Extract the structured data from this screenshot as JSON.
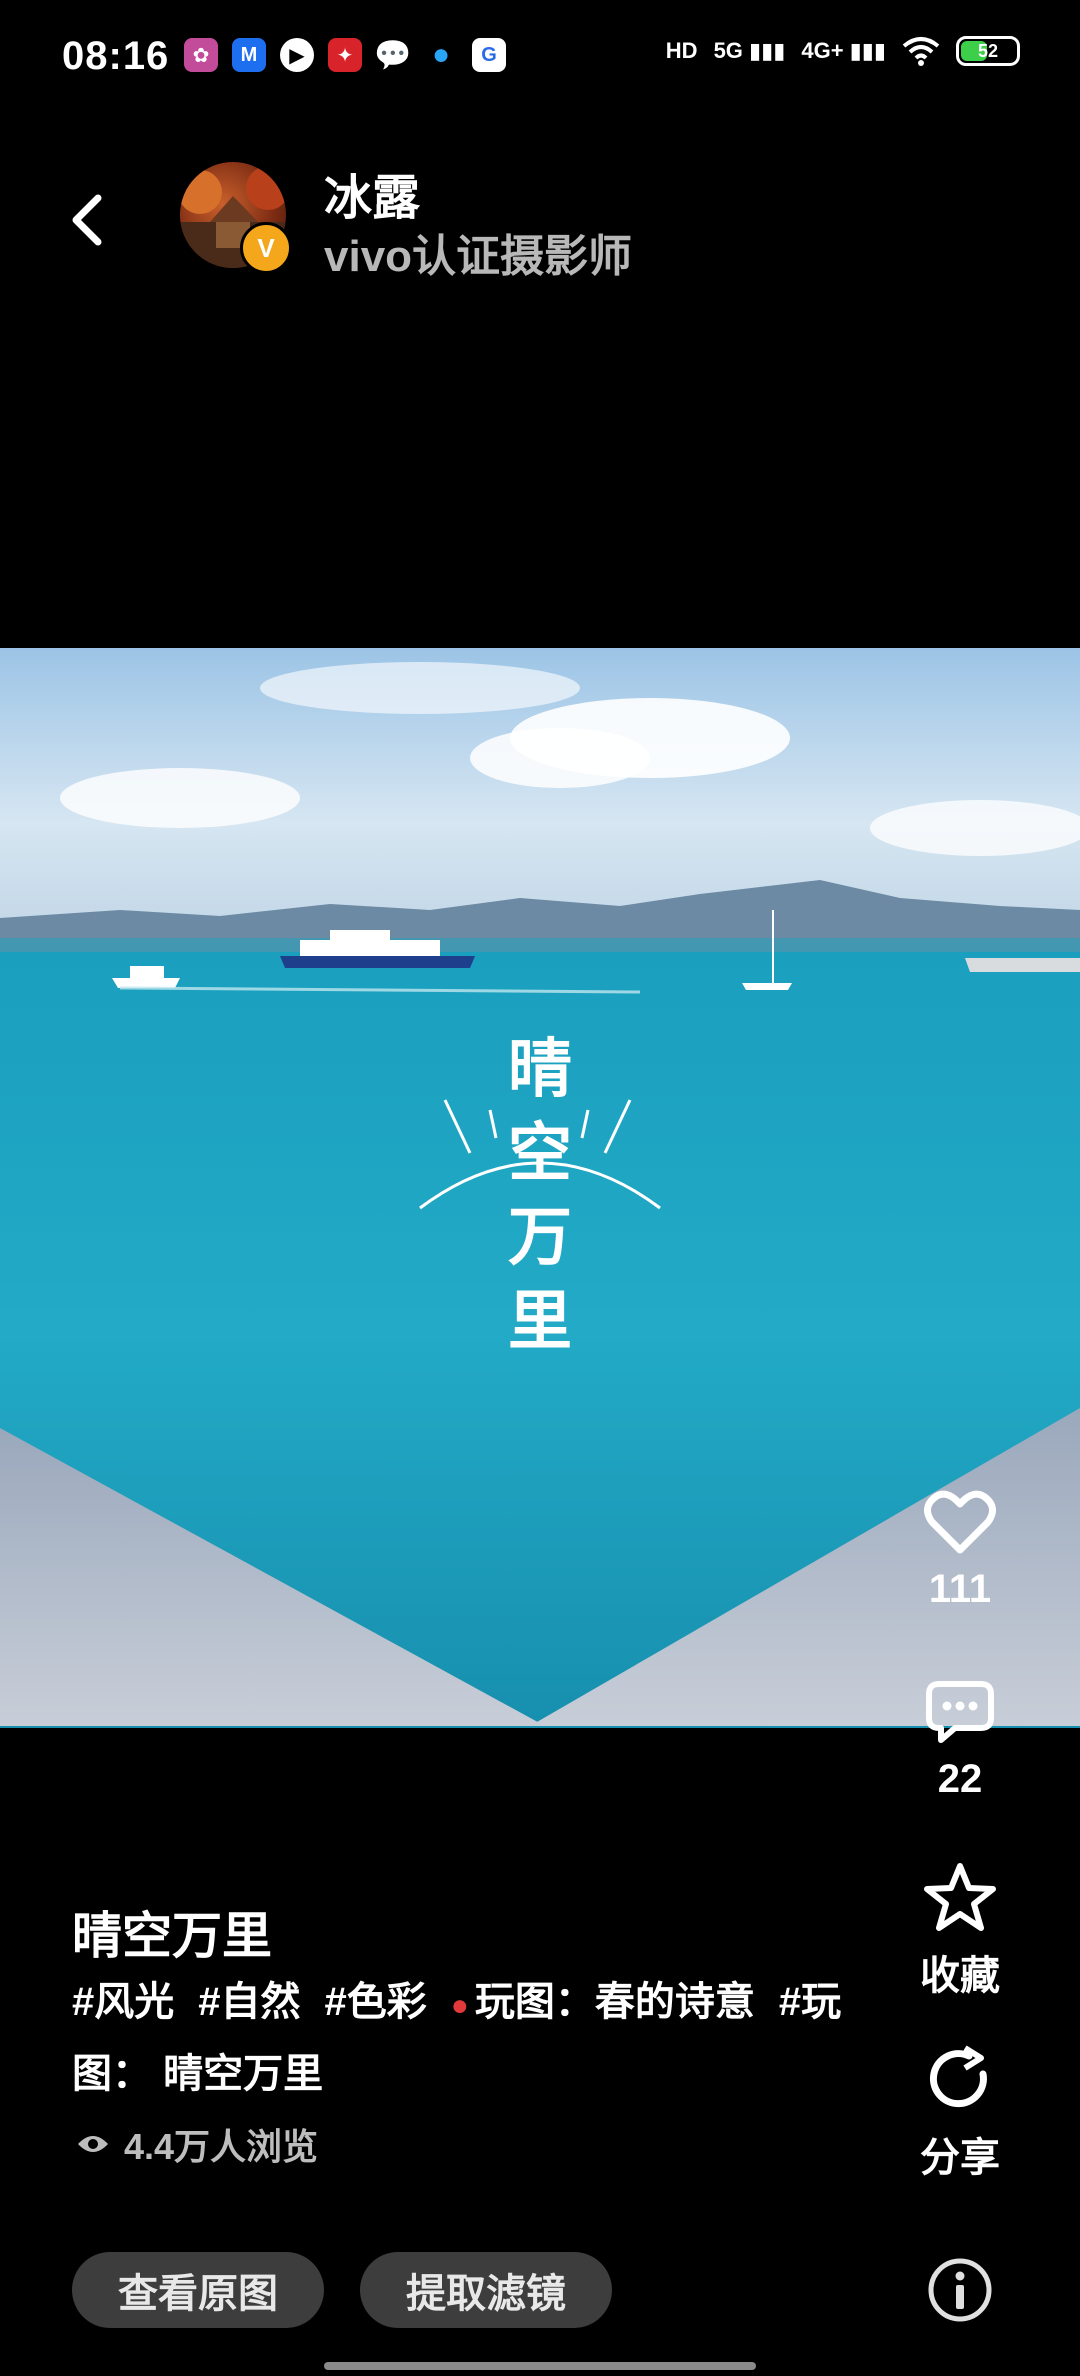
{
  "status": {
    "time": "08:16",
    "network_5g": "5G",
    "network_4g": "4G+",
    "hd_label": "HD",
    "battery_level": "52",
    "battery_fraction": 0.52
  },
  "header": {
    "username": "冰露",
    "subtitle": "vivo认证摄影师",
    "badge_letter": "V"
  },
  "photo": {
    "overlay_text": [
      "晴",
      "空",
      "万",
      "里"
    ]
  },
  "actions": {
    "like_count": "111",
    "comment_count": "22",
    "favorite_label": "收藏",
    "share_label": "分享"
  },
  "post": {
    "title": "晴空万里",
    "tags": [
      "#风光",
      "#自然",
      "#色彩",
      "玩图：春的诗意",
      "#玩图：  晴空万里"
    ],
    "views": "4.4万人浏览"
  },
  "bottom": {
    "view_original_label": "查看原图",
    "extract_filter_label": "提取滤镜"
  },
  "colors": {
    "background": "#000000",
    "accent_badge": "#f4a71b",
    "pill_bg": "#3d3d3d",
    "sea": "#1fa6c4"
  }
}
